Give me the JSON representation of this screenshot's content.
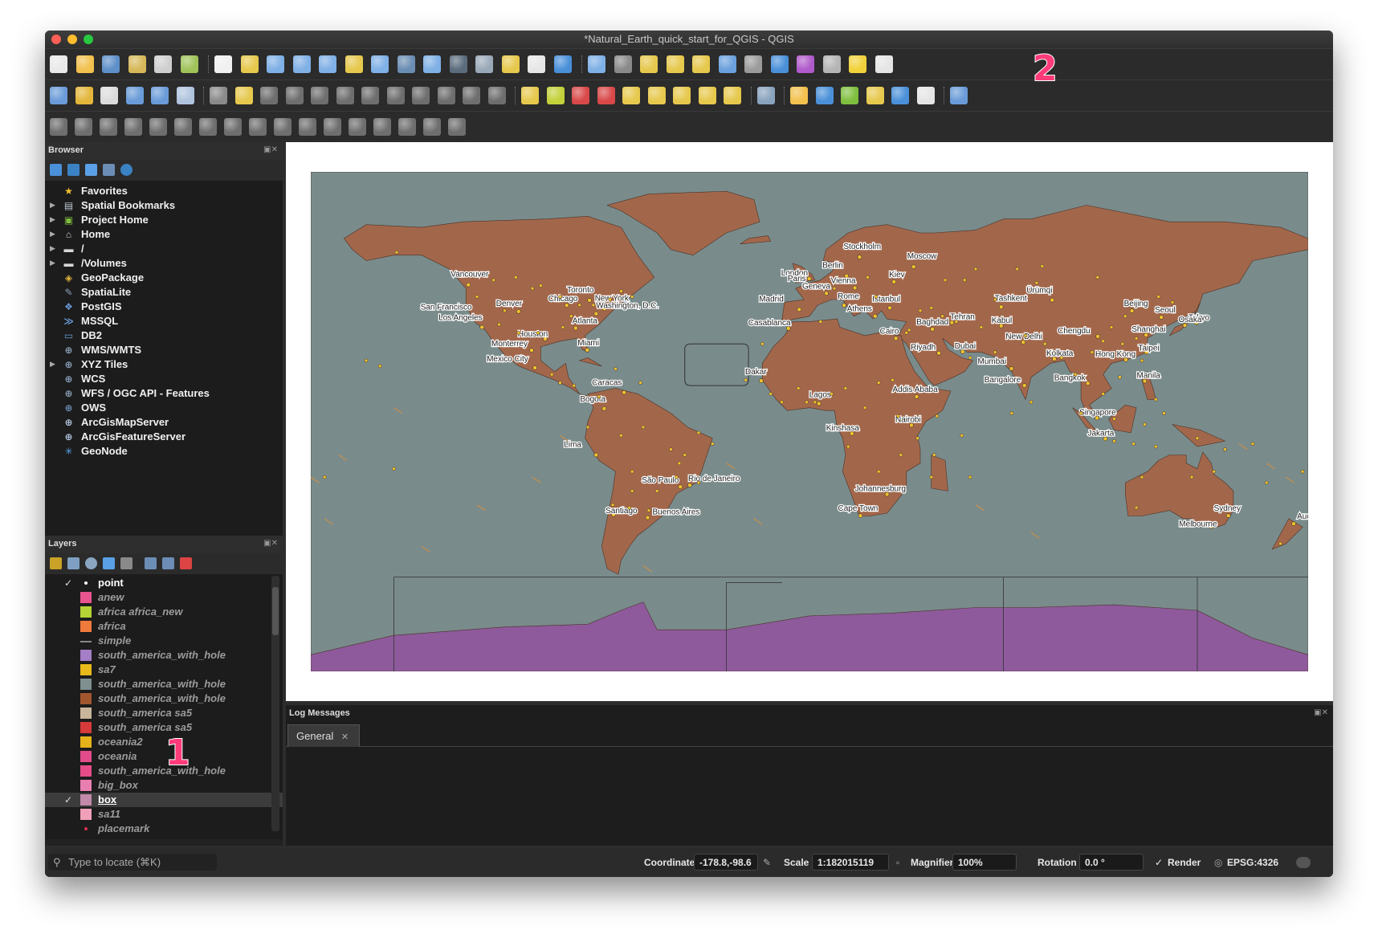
{
  "window": {
    "title": "*Natural_Earth_quick_start_for_QGIS - QGIS"
  },
  "annotations": [
    "1",
    "2"
  ],
  "browser": {
    "title": "Browser",
    "items": [
      {
        "label": "Favorites",
        "icon": "star-icon"
      },
      {
        "label": "Spatial Bookmarks",
        "icon": "bookmark-icon"
      },
      {
        "label": "Project Home",
        "icon": "project-home-icon"
      },
      {
        "label": "Home",
        "icon": "home-icon"
      },
      {
        "label": "/",
        "icon": "folder-icon"
      },
      {
        "label": "/Volumes",
        "icon": "folder-icon"
      },
      {
        "label": "GeoPackage",
        "icon": "geopackage-icon"
      },
      {
        "label": "SpatiaLite",
        "icon": "spatialite-icon"
      },
      {
        "label": "PostGIS",
        "icon": "postgis-icon"
      },
      {
        "label": "MSSQL",
        "icon": "mssql-icon"
      },
      {
        "label": "DB2",
        "icon": "db2-icon"
      },
      {
        "label": "WMS/WMTS",
        "icon": "wms-icon"
      },
      {
        "label": "XYZ Tiles",
        "icon": "xyz-icon"
      },
      {
        "label": "WCS",
        "icon": "wcs-icon"
      },
      {
        "label": "WFS / OGC API - Features",
        "icon": "wfs-icon"
      },
      {
        "label": "OWS",
        "icon": "ows-icon"
      },
      {
        "label": "ArcGisMapServer",
        "icon": "arcgis-map-icon"
      },
      {
        "label": "ArcGisFeatureServer",
        "icon": "arcgis-feature-icon"
      },
      {
        "label": "GeoNode",
        "icon": "geonode-icon"
      }
    ]
  },
  "layers": {
    "title": "Layers",
    "items": [
      {
        "label": "point",
        "color": "#ffffff",
        "checked": true,
        "active": true
      },
      {
        "label": "anew",
        "color": "#e8548e",
        "checked": false
      },
      {
        "label": "africa africa_new",
        "color": "#b5d336",
        "checked": false
      },
      {
        "label": "africa",
        "color": "#f07a3c",
        "checked": false
      },
      {
        "label": "simple",
        "color": "#888888",
        "checked": false,
        "line": true
      },
      {
        "label": "south_america_with_hole",
        "color": "#a47ec6",
        "checked": false
      },
      {
        "label": "sa7",
        "color": "#e8b91a",
        "checked": false
      },
      {
        "label": "south_america_with_hole",
        "color": "#7f8f90",
        "checked": false
      },
      {
        "label": "south_america_with_hole",
        "color": "#a2562e",
        "checked": false
      },
      {
        "label": "south_america sa5",
        "color": "#c8b59a",
        "checked": false
      },
      {
        "label": "south_america sa5",
        "color": "#d63a3a",
        "checked": false
      },
      {
        "label": "oceania2",
        "color": "#e5b21a",
        "checked": false
      },
      {
        "label": "oceania",
        "color": "#e24b8a",
        "checked": false
      },
      {
        "label": "south_america_with_hole",
        "color": "#e54c88",
        "checked": false
      },
      {
        "label": "big_box",
        "color": "#e97fb0",
        "checked": false
      },
      {
        "label": "box",
        "color": "#c28aa8",
        "checked": true,
        "active": true,
        "selected": true
      },
      {
        "label": "sa11",
        "color": "#f0a0b8",
        "checked": false
      },
      {
        "label": "placemark",
        "color": "#d9304f",
        "checked": false
      }
    ]
  },
  "map": {
    "cities": [
      {
        "name": "Vancouver"
      },
      {
        "name": "San Francisco"
      },
      {
        "name": "Los Angeles"
      },
      {
        "name": "Denver"
      },
      {
        "name": "Chicago"
      },
      {
        "name": "Toronto"
      },
      {
        "name": "New York"
      },
      {
        "name": "Washington, D.C."
      },
      {
        "name": "Atlanta"
      },
      {
        "name": "Houston"
      },
      {
        "name": "Miami"
      },
      {
        "name": "Monterrey"
      },
      {
        "name": "Mexico City"
      },
      {
        "name": "Caracas"
      },
      {
        "name": "Bogota"
      },
      {
        "name": "Lima"
      },
      {
        "name": "São Paulo"
      },
      {
        "name": "Rio de Janeiro"
      },
      {
        "name": "Santiago"
      },
      {
        "name": "Buenos Aires"
      },
      {
        "name": "Stockholm"
      },
      {
        "name": "Moscow"
      },
      {
        "name": "London"
      },
      {
        "name": "Berlin"
      },
      {
        "name": "Kiev"
      },
      {
        "name": "Paris"
      },
      {
        "name": "Vienna"
      },
      {
        "name": "Geneva"
      },
      {
        "name": "Madrid"
      },
      {
        "name": "Rome"
      },
      {
        "name": "Istanbul"
      },
      {
        "name": "Athens"
      },
      {
        "name": "Casablanca"
      },
      {
        "name": "Cairo"
      },
      {
        "name": "Baghdad"
      },
      {
        "name": "Tehran"
      },
      {
        "name": "Riyadh"
      },
      {
        "name": "Dubai"
      },
      {
        "name": "Tashkent"
      },
      {
        "name": "Kabul"
      },
      {
        "name": "Ürümqi"
      },
      {
        "name": "New Delhi"
      },
      {
        "name": "Mumbai"
      },
      {
        "name": "Kolkata"
      },
      {
        "name": "Bangalore"
      },
      {
        "name": "Beijing"
      },
      {
        "name": "Seoul"
      },
      {
        "name": "Tokyo"
      },
      {
        "name": "Shanghai"
      },
      {
        "name": "Osaka"
      },
      {
        "name": "Chengdu"
      },
      {
        "name": "Taipei"
      },
      {
        "name": "Hong Kong"
      },
      {
        "name": "Bangkok"
      },
      {
        "name": "Manila"
      },
      {
        "name": "Singapore"
      },
      {
        "name": "Jakarta"
      },
      {
        "name": "Dakar"
      },
      {
        "name": "Lagos"
      },
      {
        "name": "Addis Ababa"
      },
      {
        "name": "Nairobi"
      },
      {
        "name": "Kinshasa"
      },
      {
        "name": "Johannesburg"
      },
      {
        "name": "Cape Town"
      },
      {
        "name": "Sydney"
      },
      {
        "name": "Melbourne"
      },
      {
        "name": "Auckland"
      }
    ],
    "colors": {
      "ocean": "#7a8b8b",
      "land": "#a2674b",
      "antarctica": "#8e5a9c",
      "point": "#f2c12e"
    }
  },
  "log": {
    "title": "Log Messages",
    "tab": "General"
  },
  "status": {
    "locate_placeholder": "Type to locate (⌘K)",
    "coordinate_label": "Coordinate",
    "coordinate_value": "-178.8,-98.6",
    "scale_label": "Scale",
    "scale_value": "1:182015119",
    "magnifier_label": "Magnifier",
    "magnifier_value": "100%",
    "rotation_label": "Rotation",
    "rotation_value": "0.0 °",
    "render_label": "Render",
    "crs": "EPSG:4326"
  }
}
